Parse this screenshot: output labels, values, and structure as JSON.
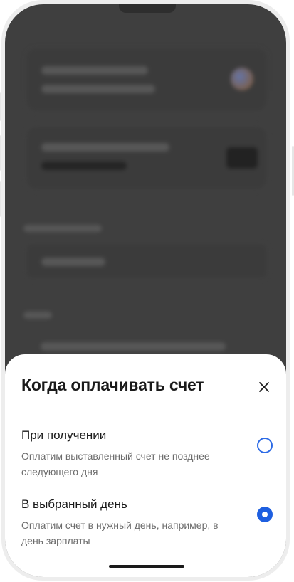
{
  "sheet": {
    "title": "Когда оплачивать счет",
    "options": [
      {
        "title": "При получении",
        "description": "Оплатим выставленный счет не позднее следующего дня",
        "selected": false
      },
      {
        "title": "В выбранный день",
        "description": "Оплатим счет в нужный день, например, в день зарплаты",
        "selected": true
      }
    ]
  },
  "icons": {
    "close": "close-icon"
  },
  "colors": {
    "accent": "#1e5fe0",
    "overlay": "#3f3f3f"
  }
}
